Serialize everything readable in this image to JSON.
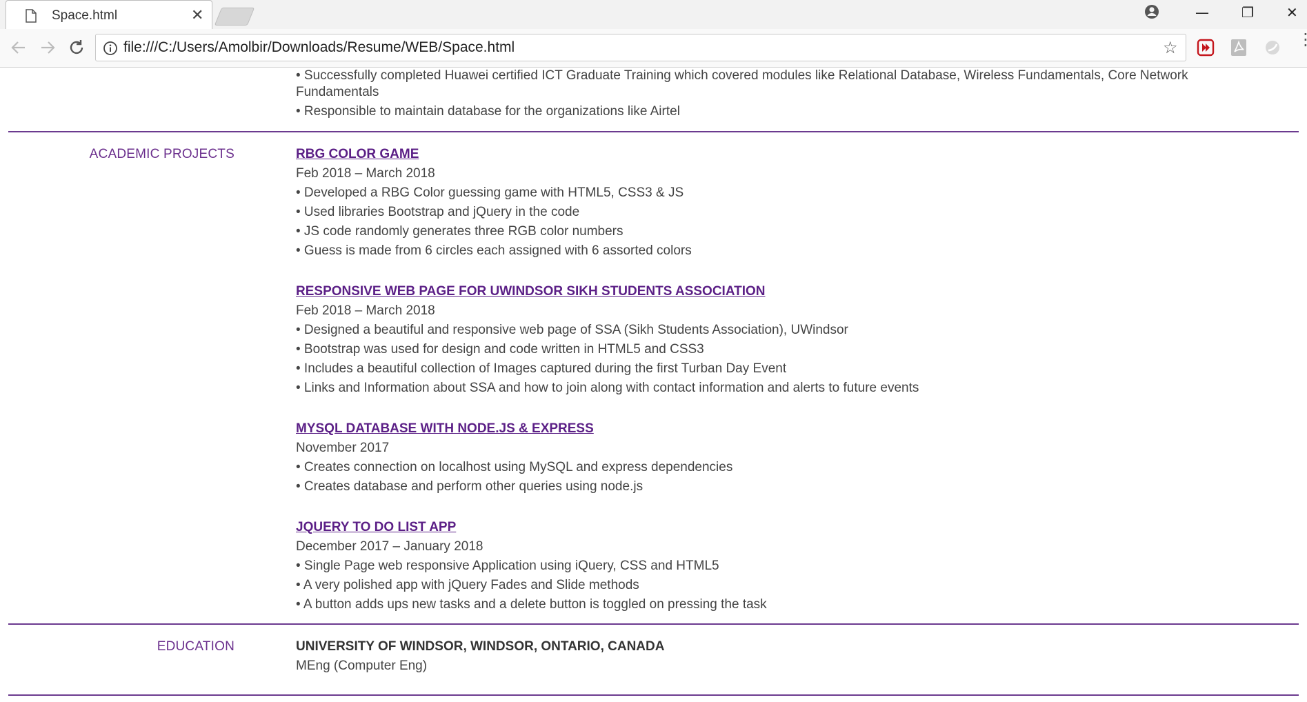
{
  "browser": {
    "tab_title": "Space.html",
    "tab_close": "✕",
    "url": "file:///C:/Users/Amolbir/Downloads/Resume/WEB/Space.html",
    "window": {
      "minimize": "—",
      "restore": "❐",
      "close": "✕"
    }
  },
  "previous_section_tail": [
    "• Successfully completed Huawei certified ICT Graduate Training which covered modules like Relational Database, Wireless Fundamentals, Core Network",
    "Fundamentals",
    "• Responsible to maintain database for the organizations like Airtel"
  ],
  "academic_projects": {
    "label": "ACADEMIC PROJECTS",
    "projects": [
      {
        "title": "RBG COLOR GAME",
        "dates": "Feb 2018 – March 2018",
        "bullets": [
          "• Developed a RBG Color guessing game with HTML5, CSS3 & JS",
          "• Used libraries Bootstrap and jQuery in the code",
          "• JS code randomly generates three RGB color numbers",
          "• Guess is made from 6 circles each assigned with 6 assorted colors"
        ]
      },
      {
        "title": "RESPONSIVE WEB PAGE FOR UWINDSOR SIKH STUDENTS ASSOCIATION",
        "dates": "Feb 2018 – March 2018",
        "bullets": [
          "• Designed a beautiful and responsive web page of SSA (Sikh Students Association), UWindsor",
          "• Bootstrap was used for design and code written in HTML5 and CSS3",
          "• Includes a beautiful collection of Images captured during the first Turban Day Event",
          "• Links and Information about SSA and how to join along with contact information and alerts to future events"
        ]
      },
      {
        "title": "MYSQL DATABASE WITH NODE.JS & EXPRESS",
        "dates": "November 2017",
        "bullets": [
          "• Creates connection on localhost using MySQL and express dependencies",
          "• Creates database and perform other queries using node.js"
        ]
      },
      {
        "title": "JQUERY TO DO LIST APP",
        "dates": "December 2017 – January 2018",
        "bullets": [
          "• Single Page web responsive Application using iQuery, CSS and HTML5",
          "• A very polished app with jQuery Fades and Slide methods",
          "• A button adds ups new tasks and a delete button is toggled on pressing the task"
        ]
      }
    ]
  },
  "education": {
    "label": "EDUCATION",
    "school": "UNIVERSITY OF WINDSOR, WINDSOR, ONTARIO, CANADA",
    "degree": "MEng (Computer Eng)"
  },
  "colors": {
    "accent": "#5b1f86",
    "divider": "#6b3a8f",
    "text": "#444444"
  }
}
